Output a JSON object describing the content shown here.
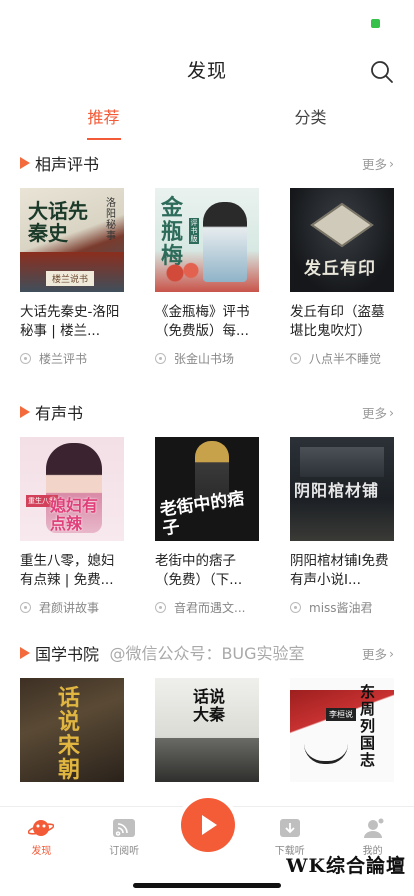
{
  "header": {
    "title": "发现"
  },
  "tabs": [
    {
      "label": "推荐"
    },
    {
      "label": "分类"
    }
  ],
  "sections": [
    {
      "title": "相声评书",
      "more": "更多",
      "items": [
        {
          "title": "大话先秦史-洛阳秘事 | 楼兰...",
          "author": "楼兰评书",
          "cover_text": "大话先秦史",
          "cover_sub": "洛阳秘事",
          "cover_tag": "楼兰说书"
        },
        {
          "title": "《金瓶梅》评书（免费版）每...",
          "author": "张金山书场",
          "cover_text": "金瓶梅",
          "cover_tag": "评书版"
        },
        {
          "title": "发丘有印（盗墓堪比鬼吹灯）",
          "author": "八点半不睡觉",
          "cover_text": "发丘有印"
        }
      ]
    },
    {
      "title": "有声书",
      "more": "更多",
      "items": [
        {
          "title": "重生八零，媳妇有点辣 | 免费...",
          "author": "君颜讲故事",
          "cover_text": "媳妇有点辣",
          "cover_tag": "重生八零"
        },
        {
          "title": "老街中的痞子（免费）（下...",
          "author": "音君而遇文...",
          "cover_text": "老街中的痞子"
        },
        {
          "title": "阴阳棺材铺I免费有声小说I...",
          "author": "miss酱油君",
          "cover_text": "阴阳棺材铺"
        }
      ]
    },
    {
      "title": "国学书院",
      "more": "更多",
      "items": [
        {
          "cover_text": "话说宋朝"
        },
        {
          "cover_text": "话说大秦"
        },
        {
          "cover_text": "东周列国志",
          "cover_tag": "李桓说"
        }
      ]
    }
  ],
  "watermark": "@微信公众号：BUG实验室",
  "tabbar": [
    {
      "label": "发现",
      "icon": "planet-icon"
    },
    {
      "label": "订阅听",
      "icon": "subscribe-icon"
    },
    {
      "label": "",
      "icon": "play-icon"
    },
    {
      "label": "下载听",
      "icon": "download-icon"
    },
    {
      "label": "我的",
      "icon": "profile-icon"
    }
  ],
  "brand": "WK综合論壇",
  "colors": {
    "accent": "#f35a37",
    "battery": "#36c24a"
  }
}
